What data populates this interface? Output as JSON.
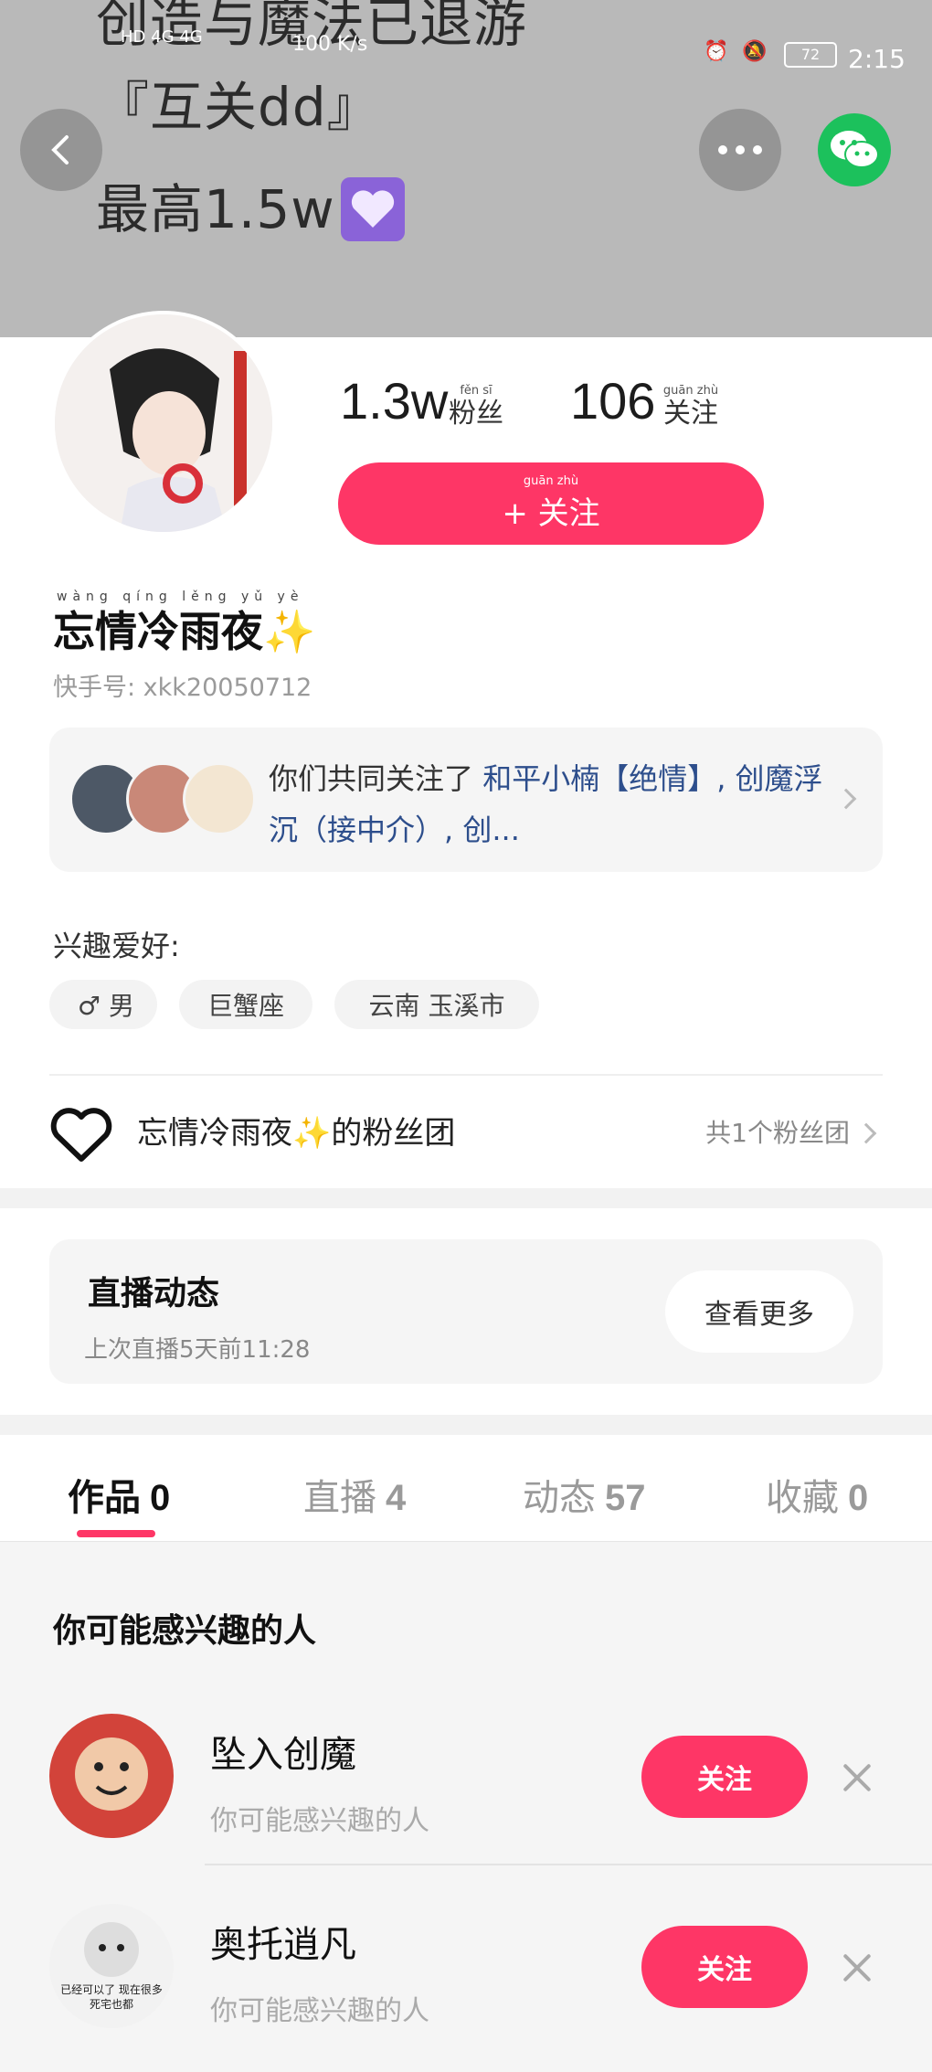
{
  "banner": {
    "line1": "创造与魔法已退游",
    "line2": "『互关dd』",
    "line3": "最高1.5w"
  },
  "status_bar": {
    "network": "HD 4G 4G",
    "speed": "100 K/s",
    "battery": "72",
    "time": "2:15"
  },
  "profile": {
    "fans_count": "1.3w",
    "fans_label": "粉丝",
    "fans_pinyin": "fěn sī",
    "following_count": "106",
    "following_label": "关注",
    "following_pinyin": "guān zhù",
    "follow_button": "+ 关注",
    "follow_button_pinyin": "guān zhù",
    "name": "忘情冷雨夜✨",
    "name_pinyin": "wàng qíng lěng yǔ yè",
    "kuaishou_id": "快手号: xkk20050712"
  },
  "common_follow": {
    "text_prefix": "你们共同关注了 ",
    "names": "和平小楠【绝情】, 创魔浮沉（接中介）, 创..."
  },
  "interests": {
    "title": "兴趣爱好:",
    "chips": [
      "♂ 男",
      "巨蟹座",
      "云南 玉溪市"
    ]
  },
  "fan_group": {
    "name": "忘情冷雨夜✨的粉丝团",
    "count": "共1个粉丝团"
  },
  "live": {
    "title": "直播动态",
    "subtitle": "上次直播5天前11:28",
    "more_button": "查看更多"
  },
  "tabs": [
    {
      "label": "作品",
      "count": "0"
    },
    {
      "label": "直播",
      "count": "4"
    },
    {
      "label": "动态",
      "count": "57"
    },
    {
      "label": "收藏",
      "count": "0"
    }
  ],
  "suggestions": {
    "title": "你可能感兴趣的人",
    "items": [
      {
        "name": "坠入创魔",
        "desc": "你可能感兴趣的人",
        "button": "关注"
      },
      {
        "name": "奥托逍凡",
        "desc": "你可能感兴趣的人",
        "button": "关注"
      }
    ],
    "avatar_caption": "已经可以了 现在很多死宅也都"
  },
  "colors": {
    "accent": "#fe3666",
    "wechat": "#1cc15c",
    "banner_bg": "#b9b9b9"
  }
}
